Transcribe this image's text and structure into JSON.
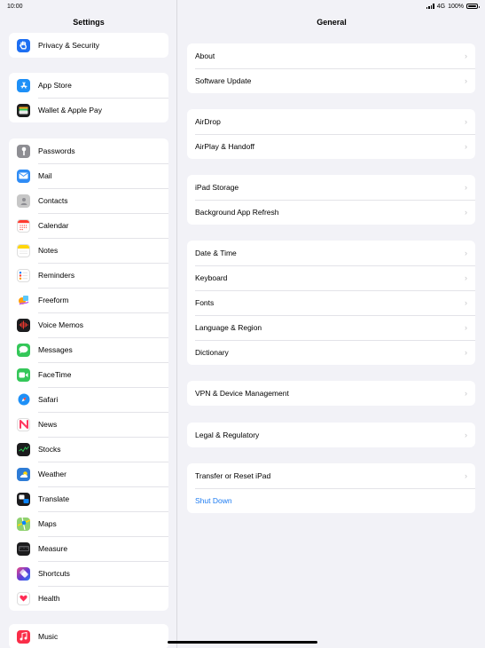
{
  "status": {
    "time": "10:00",
    "network": "4G",
    "battery": "100%"
  },
  "sidebar": {
    "title": "Settings",
    "groups": [
      [
        {
          "label": "Privacy & Security",
          "icon": "hand-icon",
          "color": "#1e6ff2"
        }
      ],
      [
        {
          "label": "App Store",
          "icon": "app-store-icon",
          "color": "#1e90f7"
        },
        {
          "label": "Wallet & Apple Pay",
          "icon": "wallet-icon",
          "color": "#1c1c1e"
        }
      ],
      [
        {
          "label": "Passwords",
          "icon": "key-icon",
          "color": "#8e8e93"
        },
        {
          "label": "Mail",
          "icon": "mail-icon",
          "color": "#2f8cf5"
        },
        {
          "label": "Contacts",
          "icon": "contacts-icon",
          "color": "#b7b7b7"
        },
        {
          "label": "Calendar",
          "icon": "calendar-icon",
          "color": "#ffffff"
        },
        {
          "label": "Notes",
          "icon": "notes-icon",
          "color": "#ffd60a"
        },
        {
          "label": "Reminders",
          "icon": "reminders-icon",
          "color": "#ffffff"
        },
        {
          "label": "Freeform",
          "icon": "freeform-icon",
          "color": "#ffffff"
        },
        {
          "label": "Voice Memos",
          "icon": "voice-memos-icon",
          "color": "#1c1c1e"
        },
        {
          "label": "Messages",
          "icon": "messages-icon",
          "color": "#34c759"
        },
        {
          "label": "FaceTime",
          "icon": "facetime-icon",
          "color": "#34c759"
        },
        {
          "label": "Safari",
          "icon": "safari-icon",
          "color": "#ffffff"
        },
        {
          "label": "News",
          "icon": "news-icon",
          "color": "#ffffff"
        },
        {
          "label": "Stocks",
          "icon": "stocks-icon",
          "color": "#1c1c1e"
        },
        {
          "label": "Weather",
          "icon": "weather-icon",
          "color": "#2e7cd6"
        },
        {
          "label": "Translate",
          "icon": "translate-icon",
          "color": "#1c1c1e"
        },
        {
          "label": "Maps",
          "icon": "maps-icon",
          "color": "#8fd16f"
        },
        {
          "label": "Measure",
          "icon": "measure-icon",
          "color": "#1c1c1e"
        },
        {
          "label": "Shortcuts",
          "icon": "shortcuts-icon",
          "color": "#5e3bd8"
        },
        {
          "label": "Health",
          "icon": "health-icon",
          "color": "#ffffff"
        }
      ],
      [
        {
          "label": "Music",
          "icon": "music-icon",
          "color": "#fa2d48"
        }
      ]
    ]
  },
  "main": {
    "title": "General",
    "groups": [
      [
        {
          "label": "About"
        },
        {
          "label": "Software Update"
        }
      ],
      [
        {
          "label": "AirDrop"
        },
        {
          "label": "AirPlay & Handoff"
        }
      ],
      [
        {
          "label": "iPad Storage"
        },
        {
          "label": "Background App Refresh"
        }
      ],
      [
        {
          "label": "Date & Time"
        },
        {
          "label": "Keyboard"
        },
        {
          "label": "Fonts"
        },
        {
          "label": "Language & Region"
        },
        {
          "label": "Dictionary"
        }
      ],
      [
        {
          "label": "VPN & Device Management"
        }
      ],
      [
        {
          "label": "Legal & Regulatory"
        }
      ],
      [
        {
          "label": "Transfer or Reset iPad"
        },
        {
          "label": "Shut Down",
          "action": true
        }
      ]
    ],
    "chevron": "›"
  }
}
